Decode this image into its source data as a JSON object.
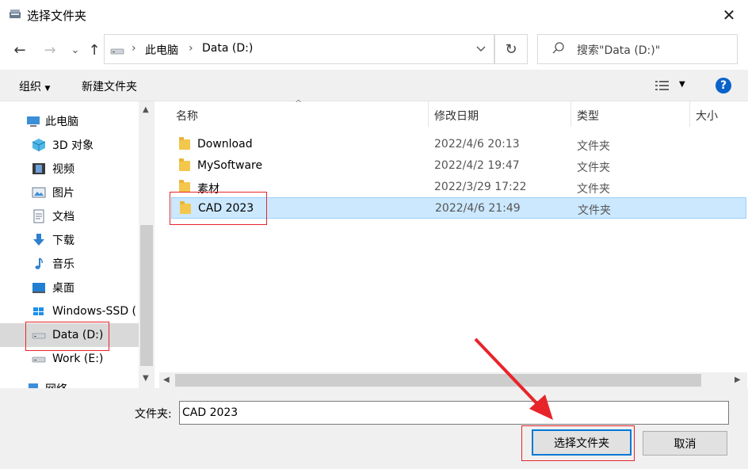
{
  "window": {
    "title": "选择文件夹",
    "close_glyph": "✕"
  },
  "nav": {
    "back_glyph": "←",
    "forward_glyph": "→",
    "recent_glyph": "⌄",
    "up_glyph": "↑",
    "breadcrumbs": [
      "此电脑",
      "Data (D:)"
    ],
    "crumb_sep": "›",
    "refresh_glyph": "↻",
    "search_placeholder": "搜索\"Data (D:)\""
  },
  "toolbar": {
    "organize_label": "组织",
    "new_folder_label": "新建文件夹",
    "help_glyph": "?"
  },
  "sidebar": {
    "items": [
      {
        "label": "此电脑",
        "icon": "computer-icon"
      },
      {
        "label": "3D 对象",
        "icon": "cube-icon"
      },
      {
        "label": "视频",
        "icon": "video-icon"
      },
      {
        "label": "图片",
        "icon": "picture-icon"
      },
      {
        "label": "文档",
        "icon": "document-icon"
      },
      {
        "label": "下载",
        "icon": "download-icon"
      },
      {
        "label": "音乐",
        "icon": "music-icon"
      },
      {
        "label": "桌面",
        "icon": "desktop-icon"
      },
      {
        "label": "Windows-SSD (",
        "icon": "windows-drive-icon"
      },
      {
        "label": "Data (D:)",
        "icon": "drive-icon"
      },
      {
        "label": "Work (E:)",
        "icon": "drive-icon"
      },
      {
        "label": "网络",
        "icon": "network-icon"
      }
    ]
  },
  "columns": {
    "name": "名称",
    "modified": "修改日期",
    "type": "类型",
    "size": "大小"
  },
  "files": [
    {
      "name": "Download",
      "modified": "2022/4/6 20:13",
      "type": "文件夹"
    },
    {
      "name": "MySoftware",
      "modified": "2022/4/2 19:47",
      "type": "文件夹"
    },
    {
      "name": "素材",
      "modified": "2022/3/29 17:22",
      "type": "文件夹"
    },
    {
      "name": "CAD 2023",
      "modified": "2022/4/6 21:49",
      "type": "文件夹"
    }
  ],
  "footer": {
    "folder_label": "文件夹:",
    "folder_value": "CAD 2023",
    "select_button": "选择文件夹",
    "cancel_button": "取消"
  },
  "colors": {
    "selection": "#cce8ff",
    "accent": "#0078d7",
    "annotation": "#e8242b"
  }
}
